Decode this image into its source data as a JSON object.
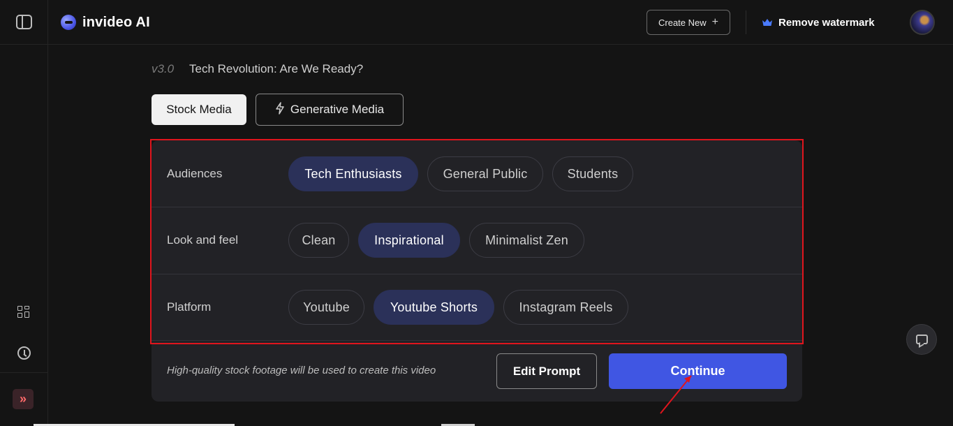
{
  "header": {
    "brand": "invideo AI",
    "create_new_label": "Create New",
    "remove_watermark_label": "Remove watermark",
    "accent_color": "#4056e3"
  },
  "sidebar": {
    "icons": [
      "sidebar-toggle-icon",
      "grid-icon",
      "clock-icon",
      "chevrons-right-icon"
    ]
  },
  "project": {
    "version": "v3.0",
    "title": "Tech Revolution: Are We Ready?"
  },
  "media_tabs": {
    "stock": "Stock Media",
    "generative": "Generative Media",
    "selected": "Stock Media"
  },
  "options": {
    "audiences": {
      "label": "Audiences",
      "chips": [
        "Tech Enthusiasts",
        "General Public",
        "Students"
      ],
      "selected": "Tech Enthusiasts"
    },
    "look_and_feel": {
      "label": "Look and feel",
      "chips": [
        "Clean",
        "Inspirational",
        "Minimalist Zen"
      ],
      "selected": "Inspirational"
    },
    "platform": {
      "label": "Platform",
      "chips": [
        "Youtube",
        "Youtube Shorts",
        "Instagram Reels"
      ],
      "selected": "Youtube Shorts"
    }
  },
  "footer": {
    "note": "High-quality stock footage will be used to create this video",
    "edit_prompt_label": "Edit Prompt",
    "continue_label": "Continue"
  }
}
